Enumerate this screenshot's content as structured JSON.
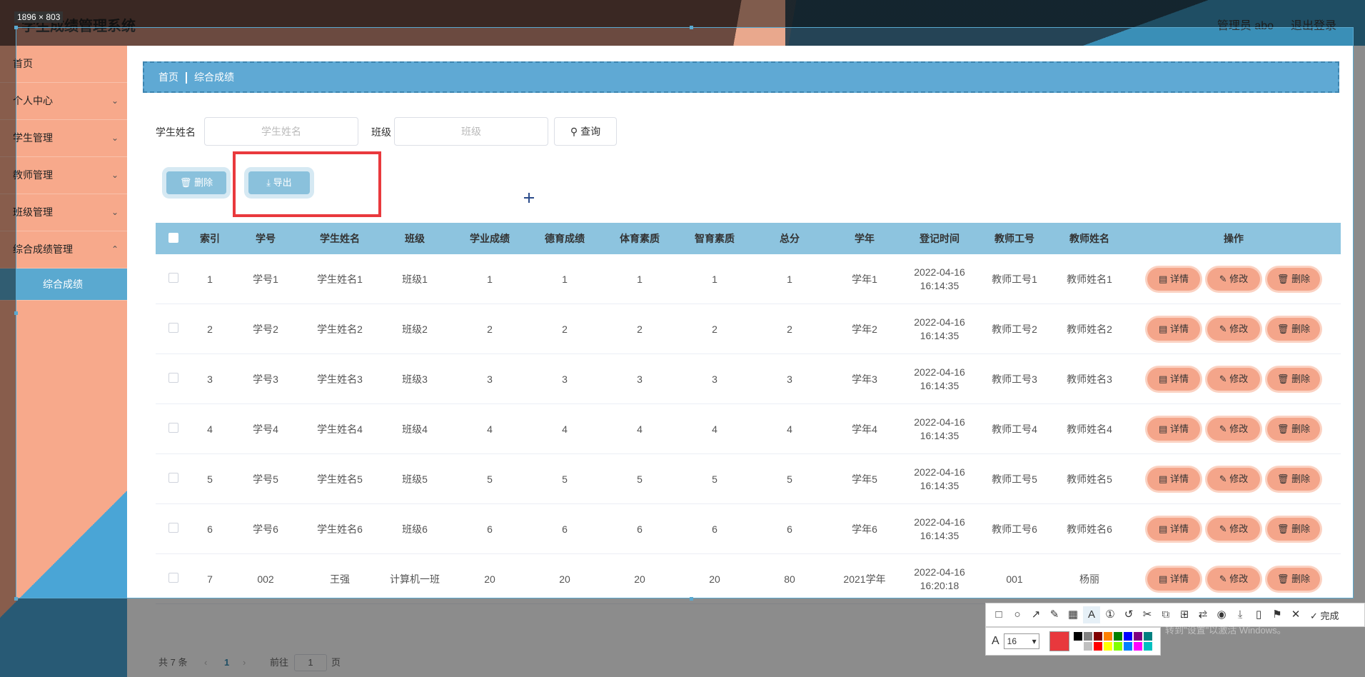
{
  "header": {
    "title": "学生成绩管理系统",
    "admin": "管理员 abo",
    "logout": "退出登录"
  },
  "sidebar": {
    "items": [
      {
        "label": "首页",
        "arrow": ""
      },
      {
        "label": "个人中心",
        "arrow": "⌄"
      },
      {
        "label": "学生管理",
        "arrow": "⌄"
      },
      {
        "label": "教师管理",
        "arrow": "⌄"
      },
      {
        "label": "班级管理",
        "arrow": "⌄"
      },
      {
        "label": "综合成绩管理",
        "arrow": "⌃"
      }
    ],
    "active_sub": "综合成绩"
  },
  "breadcrumb": {
    "home": "首页",
    "current": "综合成绩"
  },
  "search": {
    "name_label": "学生姓名",
    "name_placeholder": "学生姓名",
    "class_label": "班级",
    "class_placeholder": "班级",
    "query_label": "查询"
  },
  "actions": {
    "delete_label": "删除",
    "export_label": "导出"
  },
  "table": {
    "headers": [
      "索引",
      "学号",
      "学生姓名",
      "班级",
      "学业成绩",
      "德育成绩",
      "体育素质",
      "智育素质",
      "总分",
      "学年",
      "登记时间",
      "教师工号",
      "教师姓名",
      "操作"
    ],
    "rows": [
      [
        "1",
        "学号1",
        "学生姓名1",
        "班级1",
        "1",
        "1",
        "1",
        "1",
        "1",
        "学年1",
        "2022-04-16",
        "16:14:35",
        "教师工号1",
        "教师姓名1"
      ],
      [
        "2",
        "学号2",
        "学生姓名2",
        "班级2",
        "2",
        "2",
        "2",
        "2",
        "2",
        "学年2",
        "2022-04-16",
        "16:14:35",
        "教师工号2",
        "教师姓名2"
      ],
      [
        "3",
        "学号3",
        "学生姓名3",
        "班级3",
        "3",
        "3",
        "3",
        "3",
        "3",
        "学年3",
        "2022-04-16",
        "16:14:35",
        "教师工号3",
        "教师姓名3"
      ],
      [
        "4",
        "学号4",
        "学生姓名4",
        "班级4",
        "4",
        "4",
        "4",
        "4",
        "4",
        "学年4",
        "2022-04-16",
        "16:14:35",
        "教师工号4",
        "教师姓名4"
      ],
      [
        "5",
        "学号5",
        "学生姓名5",
        "班级5",
        "5",
        "5",
        "5",
        "5",
        "5",
        "学年5",
        "2022-04-16",
        "16:14:35",
        "教师工号5",
        "教师姓名5"
      ],
      [
        "6",
        "学号6",
        "学生姓名6",
        "班级6",
        "6",
        "6",
        "6",
        "6",
        "6",
        "学年6",
        "2022-04-16",
        "16:14:35",
        "教师工号6",
        "教师姓名6"
      ],
      [
        "7",
        "002",
        "王强",
        "计算机一班",
        "20",
        "20",
        "20",
        "20",
        "80",
        "2021学年",
        "2022-04-16",
        "16:20:18",
        "001",
        "杨丽"
      ]
    ],
    "op_labels": {
      "detail": "详情",
      "edit": "修改",
      "delete": "删除"
    }
  },
  "pagination": {
    "total": "共 7 条",
    "prev": "‹",
    "current": "1",
    "next": "›",
    "goto": "前往",
    "page_value": "1",
    "page_unit": "页"
  },
  "overlay": {
    "size_badge": "1896 × 803",
    "toolbar_done": "完成",
    "font_size": "16",
    "watermark": "激活 Windows",
    "watermark_sub": "转到\"设置\"以激活 Windows。",
    "current_color": "#e8383d",
    "palette": [
      "#000000",
      "#808080",
      "#800000",
      "#ff8000",
      "#008000",
      "#0000ff",
      "#800080",
      "#008080",
      "#ffffff",
      "#c0c0c0",
      "#ff0000",
      "#ffff00",
      "#80ff00",
      "#0080ff",
      "#ff00ff",
      "#00c0c0"
    ]
  }
}
